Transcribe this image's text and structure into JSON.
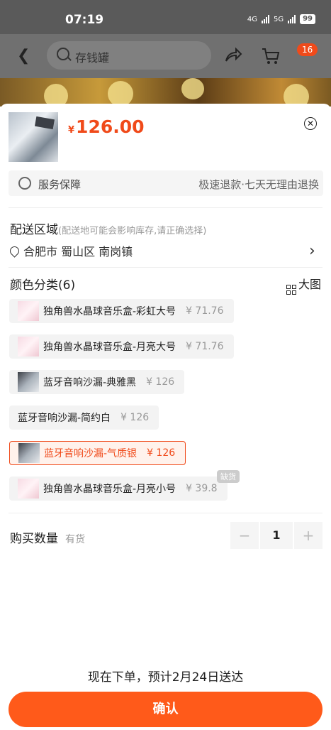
{
  "status_bar": {
    "time": "07:19",
    "net1": "4G",
    "net2": "5G",
    "battery": "99"
  },
  "nav": {
    "search_placeholder": "存钱罐",
    "cart_badge": "16"
  },
  "product": {
    "currency": "¥",
    "price": "126.00"
  },
  "service": {
    "label": "服务保障",
    "value": "极速退款·七天无理由退换"
  },
  "delivery": {
    "title": "配送区域",
    "hint": "(配送地可能会影响库存,请正确选择)",
    "address": "合肥市 蜀山区 南岗镇"
  },
  "colors": {
    "title": "颜色分类(6)",
    "big_image": "大图",
    "out_of_stock": "缺货",
    "options": [
      {
        "name": "独角兽水晶球音乐盒-彩虹大号",
        "price": "¥ 71.76",
        "thumb": "pink",
        "selected": false
      },
      {
        "name": "独角兽水晶球音乐盒-月亮大号",
        "price": "¥ 71.76",
        "thumb": "pink",
        "selected": false
      },
      {
        "name": "蓝牙音响沙漏-典雅黑",
        "price": "¥ 126",
        "thumb": "gray",
        "selected": false
      },
      {
        "name": "蓝牙音响沙漏-简约白",
        "price": "¥ 126",
        "thumb": "",
        "selected": false
      },
      {
        "name": "蓝牙音响沙漏-气质银",
        "price": "¥ 126",
        "thumb": "gray",
        "selected": true
      },
      {
        "name": "独角兽水晶球音乐盒-月亮小号",
        "price": "¥ 39.8",
        "thumb": "pink",
        "selected": false
      }
    ]
  },
  "quantity": {
    "label": "购买数量",
    "stock": "有货",
    "value": "1",
    "minus": "−",
    "plus": "+"
  },
  "footer": {
    "eta": "现在下单，预计2月24日送达",
    "confirm": "确认"
  },
  "colors_theme": {
    "accent": "#ff5a1a",
    "price": "#f04a1a"
  }
}
